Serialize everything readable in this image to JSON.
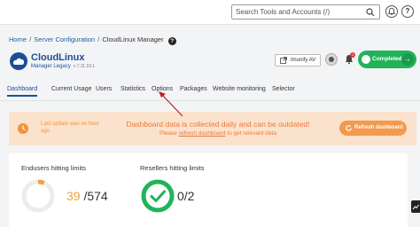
{
  "header": {
    "search_placeholder": "Search Tools and Accounts (/)",
    "bell_label": " ",
    "help_label": "?",
    "logout_label": "→"
  },
  "breadcrumb": {
    "items": [
      "Home",
      "Server Configuration",
      "CloudLinux Manager"
    ],
    "separator": "/"
  },
  "brand": {
    "title": "CloudLinux",
    "subtitle": "Manager Legacy",
    "version": "v 7.11.19.1"
  },
  "actions": {
    "imunify_label": "Imunify AV",
    "notifications_count": "1",
    "completed_label": "Completed",
    "completed_arrow": "→"
  },
  "tabs": [
    {
      "label": "Dashboard",
      "active": true
    },
    {
      "label": "Current Usage",
      "active": false
    },
    {
      "label": "Users",
      "active": false
    },
    {
      "label": "Statistics",
      "active": false
    },
    {
      "label": "Options",
      "active": false
    },
    {
      "label": "Packages",
      "active": false
    },
    {
      "label": "Website monitoring",
      "active": false
    },
    {
      "label": "Selector",
      "active": false
    }
  ],
  "banner": {
    "last_update": "Last update was an hour ago",
    "message": "Dashboard data is collected daily and can be outdated!",
    "sub_prefix": "Please",
    "sub_link": "refresh dashboard",
    "sub_suffix": "to get relevant data",
    "refresh_label": "Refresh dashboard"
  },
  "stats": {
    "endusers": {
      "title": "Endusers hitting limits",
      "hitting": "39",
      "total": "/574",
      "fraction": 0.068
    },
    "resellers": {
      "title": "Resellers hitting limits",
      "value": "0/2"
    }
  },
  "colors": {
    "accent": "#1c4e96",
    "success": "#22b35a",
    "warning_bg": "#fbe2cc",
    "warning_text": "#e8793d",
    "pointer": "#c0202a"
  }
}
